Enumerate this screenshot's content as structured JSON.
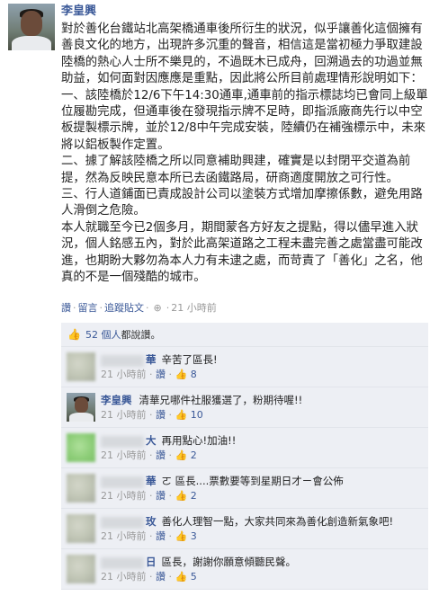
{
  "post": {
    "author": "李皇興",
    "paragraphs": [
      "對於善化台鐵站北高架橋通車後所衍生的狀況，似乎讓善化這個擁有善良文化的地方，出現許多沉重的聲音，相信這是當初極力爭取建設陸橋的熱心人士所不樂見的，不過既木已成舟，回溯過去的功過並無助益，如何面對因應應是重點，因此將公所目前處理情形說明如下：",
      "一、該陸橋於12/6下午14:30通車,通車前的指示標誌均已會同上級單位履勘完成，但通車後在發現指示牌不足時，即指派廠商先行以中空板提製標示牌，並於12/8中午完成安裝，陸續仍在補強標示中，未來將以鋁板製作定置。",
      "二、據了解該陸橋之所以同意補助興建，確實是以封閉平交道為前提，然為反映民意本所已去函鐵路局，研商適度開放之可行性。",
      "三、行人道鋪面已責成設計公司以塗裝方式增加摩擦係數，避免用路人滑倒之危險。",
      "本人就職至今已2個多月，期間蒙各方好友之提點，得以儘早進入狀況，個人銘感五內，對於此高架道路之工程未盡完善之處當盡可能改進，也期盼大夥勿為本人力有未逮之處，而苛責了「善化」之名，他真的不是一個殘酷的城市。"
    ]
  },
  "actions": {
    "like": "讚",
    "comment": "留言",
    "unfollow": "追蹤貼文",
    "time": "21 小時前"
  },
  "likes": {
    "count_text": "52 個人",
    "suffix": "都說讚。"
  },
  "comments": [
    {
      "author": "華",
      "text": "辛苦了區長!",
      "time": "21 小時前",
      "like": "讚",
      "count": "8"
    },
    {
      "author": "李皇興",
      "text": "清華兄哪件社服獲選了，粉期待喔!!",
      "time": "21 小時前",
      "like": "讚",
      "count": "10"
    },
    {
      "author": "大",
      "text": "再用點心!加油!!",
      "time": "21 小時前",
      "like": "讚",
      "count": "2"
    },
    {
      "author": "華",
      "text": "ㄛ 區長....票數要等到星期日才ㄧ會公佈",
      "time": "21 小時前",
      "like": "讚",
      "count": "2"
    },
    {
      "author": "玫",
      "text": "善化人理智一點，大家共同來為善化創造新氣象吧!",
      "time": "21 小時前",
      "like": "讚",
      "count": "3"
    },
    {
      "author": "日",
      "text": "區長，謝謝你願意傾聽民聲。",
      "time": "21 小時前",
      "like": "讚",
      "count": "5"
    }
  ],
  "colors": {
    "link": "#3b5998",
    "comment_bg": "#edeff4",
    "meta": "#999999"
  },
  "icons": {
    "like": "thumbs-up-icon",
    "globe": "globe-icon"
  }
}
